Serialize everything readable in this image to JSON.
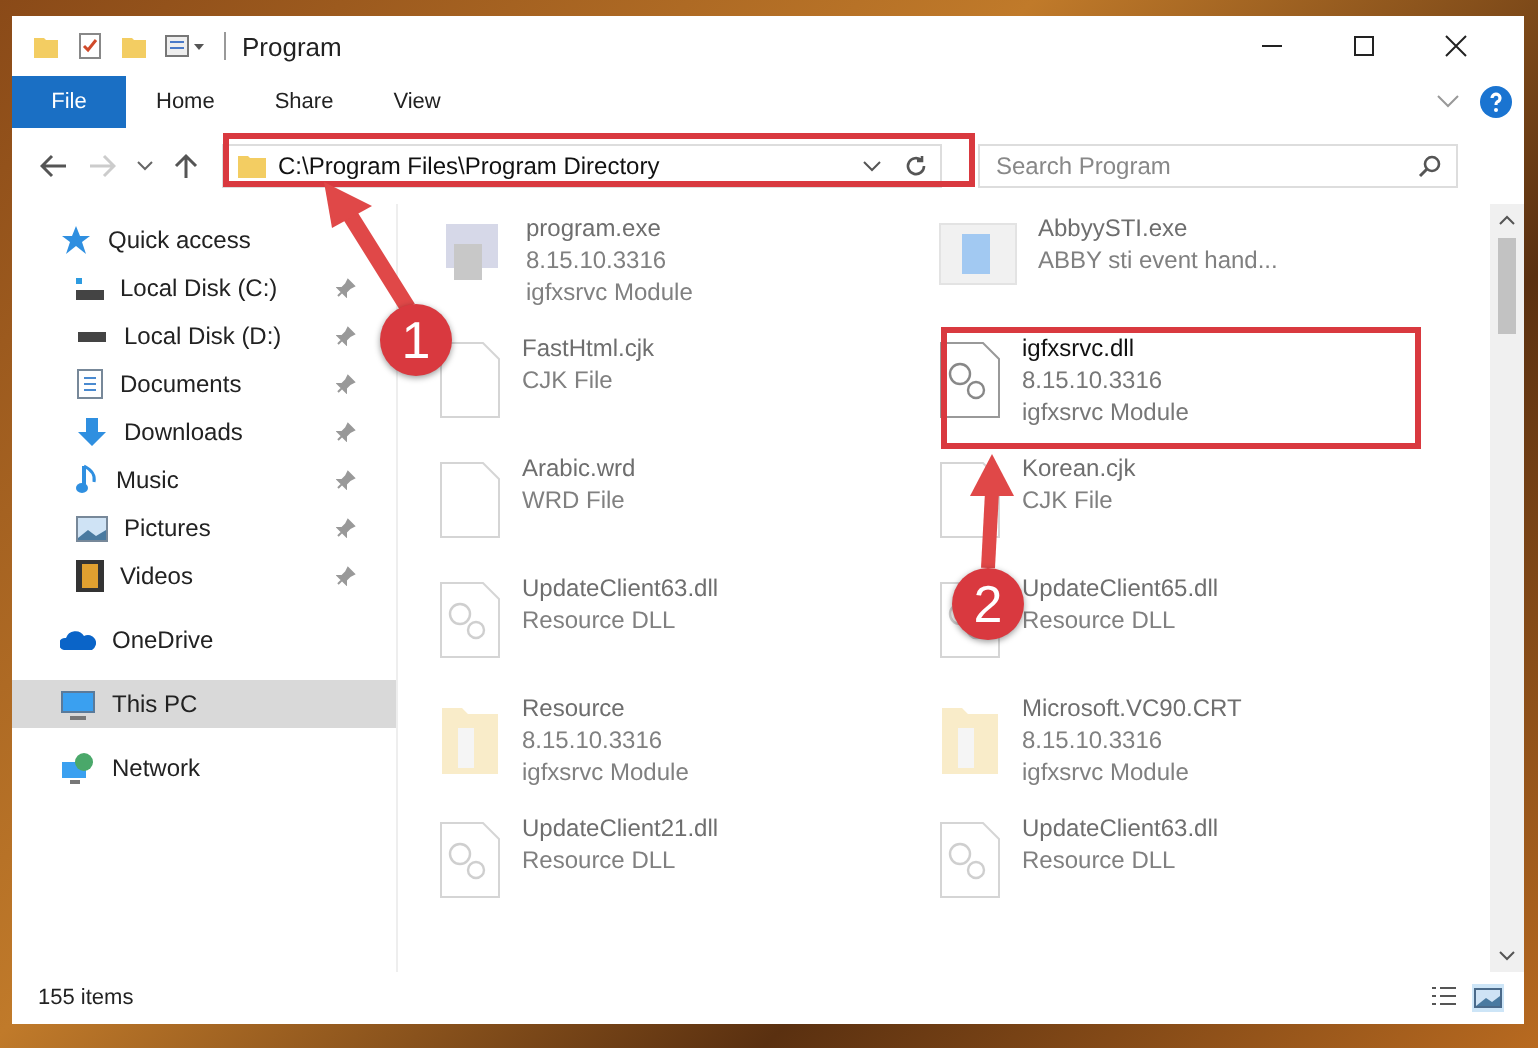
{
  "window": {
    "title": "Program"
  },
  "ribbon_tabs": [
    {
      "label": "File",
      "selected": true
    },
    {
      "label": "Home",
      "selected": false
    },
    {
      "label": "Share",
      "selected": false
    },
    {
      "label": "View",
      "selected": false
    }
  ],
  "navigation": {
    "back_disabled": false,
    "forward_disabled": true
  },
  "address_bar": {
    "path": "C:\\Program Files\\Program Directory"
  },
  "search": {
    "placeholder": "Search Program"
  },
  "sidebar": {
    "items": [
      {
        "label": "Quick access",
        "kind": "star",
        "selected": false,
        "children": [
          {
            "label": "Local Disk (C:)",
            "kind": "drive-c",
            "selected": false,
            "pinned": true
          },
          {
            "label": "Local Disk (D:)",
            "kind": "drive",
            "selected": false,
            "pinned": true
          },
          {
            "label": "Documents",
            "kind": "document",
            "selected": false,
            "pinned": true
          },
          {
            "label": "Downloads",
            "kind": "download",
            "selected": false,
            "pinned": true
          },
          {
            "label": "Music",
            "kind": "music",
            "selected": false,
            "pinned": true
          },
          {
            "label": "Pictures",
            "kind": "picture",
            "selected": false,
            "pinned": true
          },
          {
            "label": "Videos",
            "kind": "video",
            "selected": false,
            "pinned": true
          }
        ]
      },
      {
        "label": "OneDrive",
        "kind": "cloud",
        "selected": false
      },
      {
        "label": "This PC",
        "kind": "pc",
        "selected": true
      },
      {
        "label": "Network",
        "kind": "network",
        "selected": false
      }
    ]
  },
  "files": [
    {
      "name": "program.exe",
      "details": [
        "8.15.10.3316",
        "igfxsrvc Module"
      ],
      "kind": "exe",
      "emphasized": false
    },
    {
      "name": "AbbyySTI.exe",
      "details": [
        "ABBY sti event hand..."
      ],
      "kind": "app",
      "emphasized": false
    },
    {
      "name": "FastHtml.cjk",
      "details": [
        "CJK File"
      ],
      "kind": "file",
      "emphasized": false
    },
    {
      "name": "igfxsrvc.dll",
      "details": [
        "8.15.10.3316",
        "igfxsrvc Module"
      ],
      "kind": "dll",
      "emphasized": true
    },
    {
      "name": "Arabic.wrd",
      "details": [
        "WRD File"
      ],
      "kind": "file",
      "emphasized": false
    },
    {
      "name": "Korean.cjk",
      "details": [
        "CJK File"
      ],
      "kind": "file",
      "emphasized": false
    },
    {
      "name": "UpdateClient63.dll",
      "details": [
        "Resource DLL"
      ],
      "kind": "dll",
      "emphasized": false
    },
    {
      "name": "UpdateClient65.dll",
      "details": [
        "Resource DLL"
      ],
      "kind": "dll",
      "emphasized": false
    },
    {
      "name": "Resource",
      "details": [
        "8.15.10.3316",
        "igfxsrvc Module"
      ],
      "kind": "folder",
      "emphasized": false
    },
    {
      "name": "Microsoft.VC90.CRT",
      "details": [
        "8.15.10.3316",
        "igfxsrvc Module"
      ],
      "kind": "folder",
      "emphasized": false
    },
    {
      "name": "UpdateClient21.dll",
      "details": [
        "Resource DLL"
      ],
      "kind": "dll",
      "emphasized": false
    },
    {
      "name": "UpdateClient63.dll",
      "details": [
        "Resource DLL"
      ],
      "kind": "dll",
      "emphasized": false
    }
  ],
  "status_bar": {
    "item_count": "155 items",
    "views": [
      {
        "kind": "details",
        "selected": false
      },
      {
        "kind": "large-icons",
        "selected": true
      }
    ]
  },
  "annotations": [
    {
      "label": "1"
    },
    {
      "label": "2"
    }
  ]
}
